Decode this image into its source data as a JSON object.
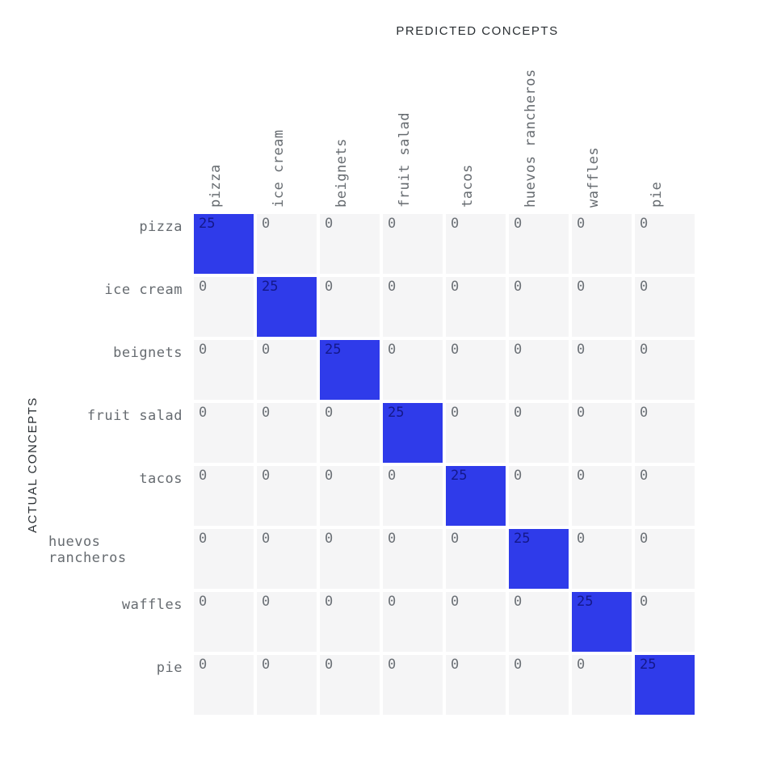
{
  "axis": {
    "x_label": "PREDICTED CONCEPTS",
    "y_label": "ACTUAL CONCEPTS"
  },
  "categories": [
    "pizza",
    "ice cream",
    "beignets",
    "fruit salad",
    "tacos",
    "huevos rancheros",
    "waffles",
    "pie"
  ],
  "matrix": [
    [
      25,
      0,
      0,
      0,
      0,
      0,
      0,
      0
    ],
    [
      0,
      25,
      0,
      0,
      0,
      0,
      0,
      0
    ],
    [
      0,
      0,
      25,
      0,
      0,
      0,
      0,
      0
    ],
    [
      0,
      0,
      0,
      25,
      0,
      0,
      0,
      0
    ],
    [
      0,
      0,
      0,
      0,
      25,
      0,
      0,
      0
    ],
    [
      0,
      0,
      0,
      0,
      0,
      25,
      0,
      0
    ],
    [
      0,
      0,
      0,
      0,
      0,
      0,
      25,
      0
    ],
    [
      0,
      0,
      0,
      0,
      0,
      0,
      0,
      25
    ]
  ],
  "colors": {
    "diagonal": "#2f3bea",
    "empty": "#f5f5f6"
  },
  "chart_data": {
    "type": "heatmap",
    "title": "",
    "xlabel": "PREDICTED CONCEPTS",
    "ylabel": "ACTUAL CONCEPTS",
    "x_categories": [
      "pizza",
      "ice cream",
      "beignets",
      "fruit salad",
      "tacos",
      "huevos rancheros",
      "waffles",
      "pie"
    ],
    "y_categories": [
      "pizza",
      "ice cream",
      "beignets",
      "fruit salad",
      "tacos",
      "huevos rancheros",
      "waffles",
      "pie"
    ],
    "values": [
      [
        25,
        0,
        0,
        0,
        0,
        0,
        0,
        0
      ],
      [
        0,
        25,
        0,
        0,
        0,
        0,
        0,
        0
      ],
      [
        0,
        0,
        25,
        0,
        0,
        0,
        0,
        0
      ],
      [
        0,
        0,
        0,
        25,
        0,
        0,
        0,
        0
      ],
      [
        0,
        0,
        0,
        0,
        25,
        0,
        0,
        0
      ],
      [
        0,
        0,
        0,
        0,
        0,
        25,
        0,
        0
      ],
      [
        0,
        0,
        0,
        0,
        0,
        0,
        25,
        0
      ],
      [
        0,
        0,
        0,
        0,
        0,
        0,
        0,
        25
      ]
    ],
    "value_range": [
      0,
      25
    ]
  }
}
